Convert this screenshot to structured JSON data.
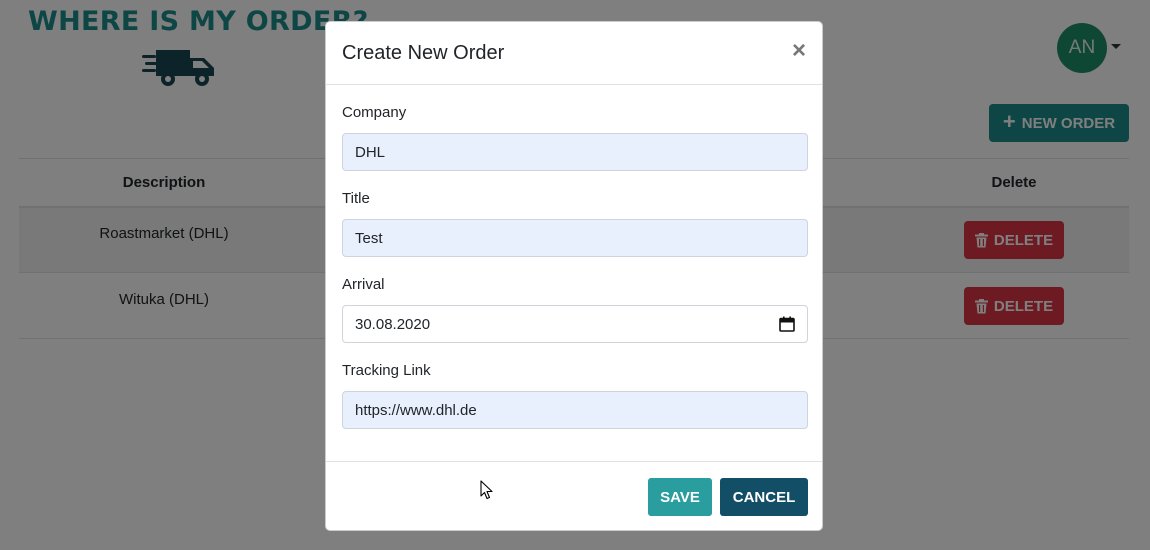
{
  "app": {
    "logo_text": "WHERE IS MY ORDER?",
    "brand_color": "#1d8c8c"
  },
  "header": {
    "avatar_initials": "AN",
    "new_order_label": "NEW ORDER",
    "new_order_icon": "plus-icon"
  },
  "table": {
    "columns": {
      "description": "Description",
      "delete": "Delete"
    },
    "rows": [
      {
        "description": "Roastmarket (DHL)",
        "delete_label": "DELETE"
      },
      {
        "description": "Wituka (DHL)",
        "delete_label": "DELETE"
      }
    ],
    "delete_icon": "trash-icon",
    "delete_color": "#dc3545"
  },
  "modal": {
    "title": "Create New Order",
    "close_symbol": "×",
    "fields": {
      "company": {
        "label": "Company",
        "value": "DHL"
      },
      "title": {
        "label": "Title",
        "value": "Test"
      },
      "arrival": {
        "label": "Arrival",
        "value": "30.08.2020"
      },
      "tracking_link": {
        "label": "Tracking Link",
        "value": "https://www.dhl.de"
      }
    },
    "save_label": "SAVE",
    "cancel_label": "CANCEL",
    "save_color": "#2a9d9f",
    "cancel_color": "#134e67"
  }
}
